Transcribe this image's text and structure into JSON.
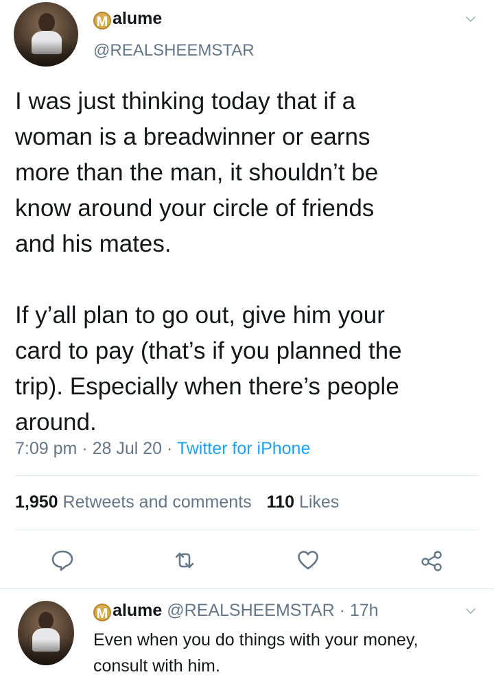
{
  "tweet": {
    "display_name_badge": "M",
    "display_name_rest": "alume",
    "handle": "@REALSHEEMSTAR",
    "paragraphs": [
      "I was just thinking today that if a\nwoman is a breadwinner or earns\nmore than the man, it shouldn’t be\nknow around your circle of friends\nand his mates.",
      "If y’all plan to go out, give him your\ncard to pay (that’s if you planned the\ntrip). Especially when there’s people\naround."
    ],
    "time": "7:09 pm",
    "date": "28 Jul 20",
    "separator": "·",
    "source": "Twitter for iPhone",
    "retweets_count": "1,950",
    "retweets_label": "Retweets and comments",
    "likes_count": "110",
    "likes_label": "Likes"
  },
  "actions": [
    {
      "name": "reply",
      "icon": "speech-bubble-icon"
    },
    {
      "name": "retweet",
      "icon": "retweet-icon"
    },
    {
      "name": "like",
      "icon": "heart-icon"
    },
    {
      "name": "share",
      "icon": "share-icon"
    }
  ],
  "reply": {
    "display_name_badge": "M",
    "display_name_rest": "alume",
    "handle": "@REALSHEEMSTAR",
    "separator": "·",
    "age": "17h",
    "text": "Even when you do things with your money,\nconsult with him."
  },
  "colors": {
    "text": "#14171a",
    "secondary": "#657786",
    "accent": "#1da1f2",
    "divider": "#e1e8ed",
    "badge": "#d9ad4f"
  }
}
